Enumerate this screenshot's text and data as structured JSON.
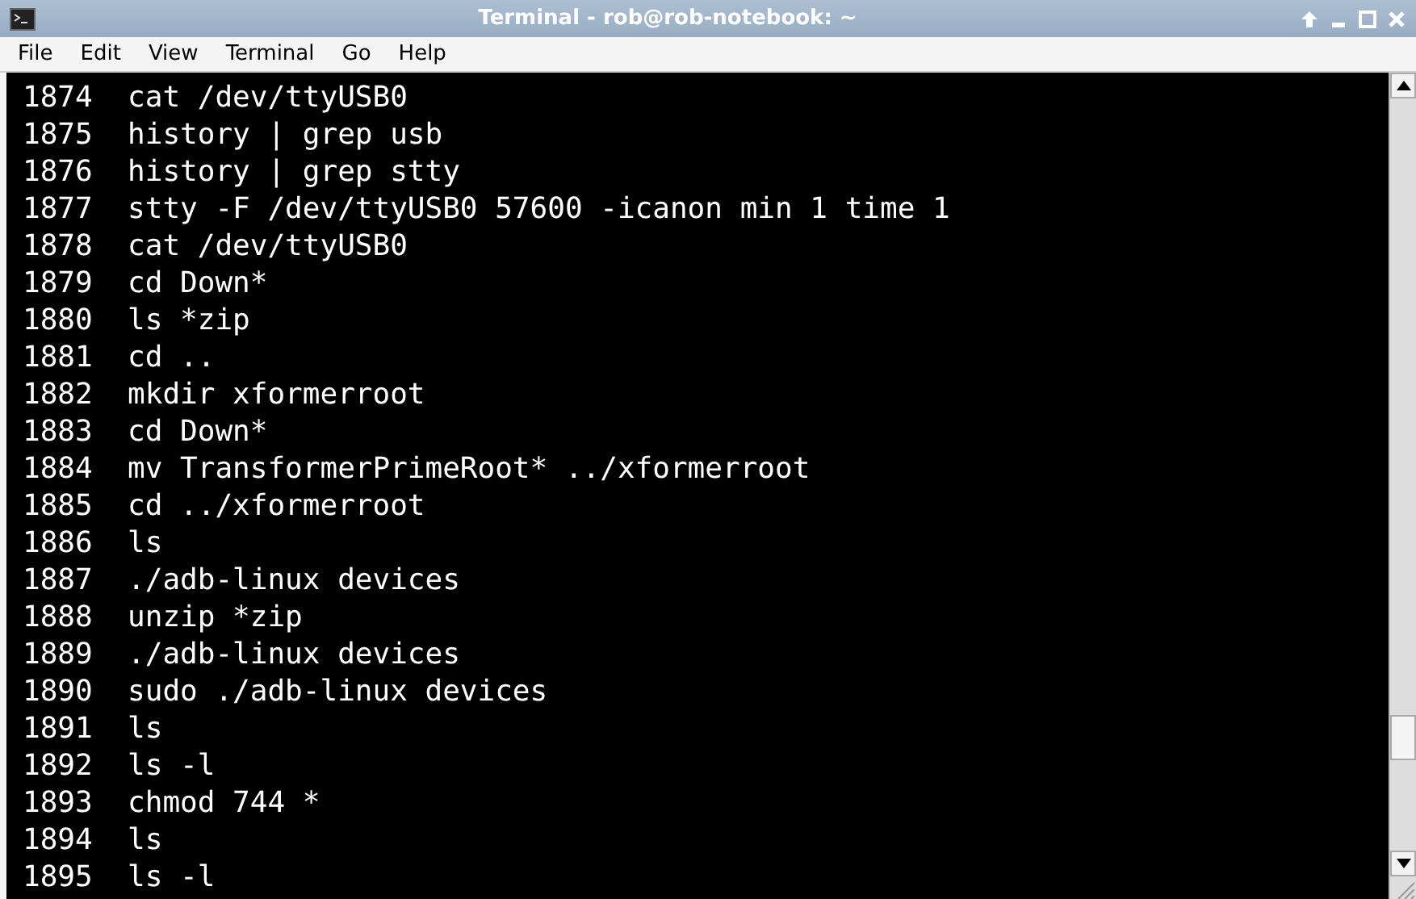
{
  "window": {
    "title": "Terminal - rob@rob-notebook: ~"
  },
  "menu": [
    "File",
    "Edit",
    "View",
    "Terminal",
    "Go",
    "Help"
  ],
  "lines": [
    "1874  cat /dev/ttyUSB0",
    "1875  history | grep usb",
    "1876  history | grep stty",
    "1877  stty -F /dev/ttyUSB0 57600 -icanon min 1 time 1",
    "1878  cat /dev/ttyUSB0",
    "1879  cd Down*",
    "1880  ls *zip",
    "1881  cd ..",
    "1882  mkdir xformerroot",
    "1883  cd Down*",
    "1884  mv TransformerPrimeRoot* ../xformerroot",
    "1885  cd ../xformerroot",
    "1886  ls",
    "1887  ./adb-linux devices",
    "1888  unzip *zip",
    "1889  ./adb-linux devices",
    "1890  sudo ./adb-linux devices",
    "1891  ls",
    "1892  ls -l",
    "1893  chmod 744 *",
    "1894  ls",
    "1895  ls -l"
  ]
}
